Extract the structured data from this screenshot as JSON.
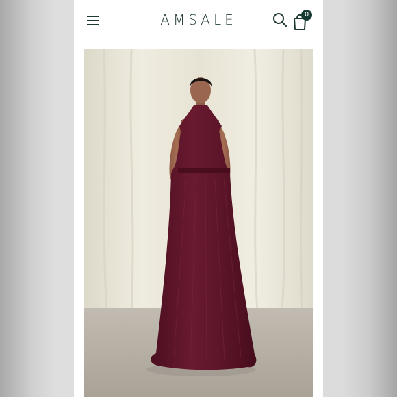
{
  "header": {
    "brand": "AMSALE",
    "cart_count": "0"
  },
  "icons": {
    "menu": "hamburger-menu-icon",
    "search": "search-icon",
    "cart": "shopping-bag-icon"
  },
  "product_image": {
    "dress_color": "#5e1529",
    "backdrop_color": "#ece9dc",
    "floor_color": "#b7b0a6"
  }
}
